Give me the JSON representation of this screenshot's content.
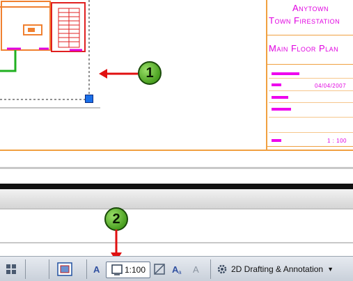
{
  "titleblock": {
    "line1": "Anytown",
    "line2": "Town Firestation",
    "line3": "Main Floor Plan",
    "date": "04/04/2007",
    "scale": "1 : 100"
  },
  "callouts": {
    "one": "1",
    "two": "2"
  },
  "statusbar": {
    "annotation_scale": "1:100",
    "workspace": "2D Drafting & Annotation"
  },
  "colors": {
    "titleblock_text": "#e000e0",
    "titleblock_border": "#f0a040",
    "callout_fill": "#6cc03a",
    "arrow": "#e01010",
    "grip": "#1a6fe8"
  },
  "icons": [
    "model-icon",
    "layout-icon",
    "annotation-visibility-icon",
    "annotation-scale-icon",
    "auto-scale-icon",
    "workspace-gear-icon",
    "dropdown-arrow-icon"
  ]
}
